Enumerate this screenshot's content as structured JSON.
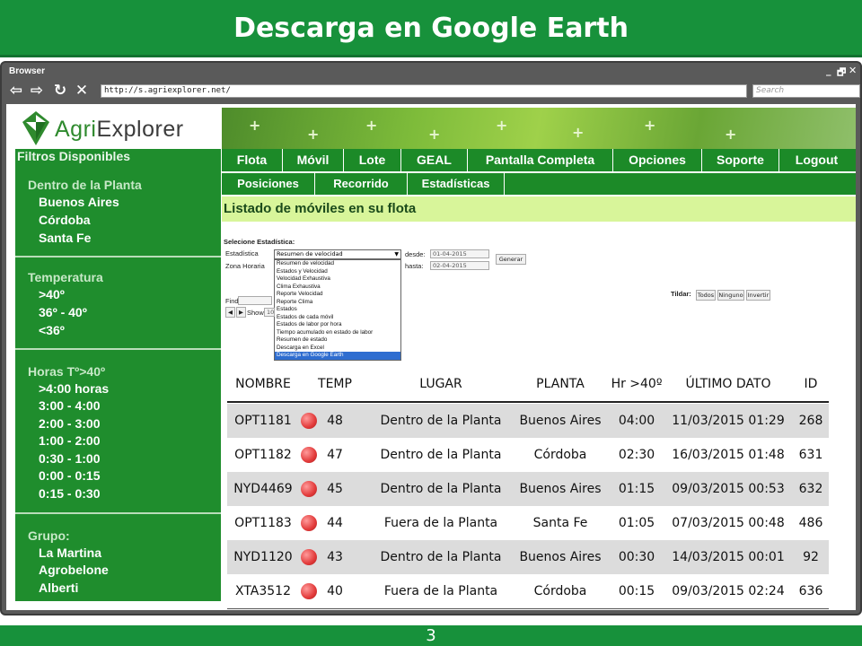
{
  "slide": {
    "title": "Descarga en Google Earth",
    "page_number": "3"
  },
  "browser": {
    "label": "Browser",
    "url": "http://s.agriexplorer.net/",
    "search_placeholder": "Search",
    "controls": {
      "minimize": "_",
      "restore": "🗗",
      "close": "✕"
    },
    "nav": {
      "back": "⇦",
      "forward": "⇨",
      "reload": "↻",
      "stop": "✕"
    }
  },
  "app": {
    "logo": {
      "prefix": "Agri",
      "suffix": "Explorer"
    },
    "sidebar": {
      "title": "Filtros Disponibles",
      "groups": [
        {
          "label": "Dentro de la Planta",
          "items": [
            "Buenos Aires",
            "Córdoba",
            "Santa Fe"
          ]
        },
        {
          "label": "Temperatura",
          "items": [
            ">40º",
            "36º - 40º",
            "<36º"
          ]
        },
        {
          "label": "Horas Tº>40º",
          "items": [
            ">4:00 horas",
            "3:00 - 4:00",
            "2:00 - 3:00",
            "1:00 - 2:00",
            "0:30 - 1:00",
            "0:00 - 0:15",
            "0:15 - 0:30"
          ]
        },
        {
          "label": "Grupo:",
          "items": [
            "La Martina",
            "Agrobelone",
            "Alberti"
          ]
        }
      ]
    },
    "main_nav": [
      "Flota",
      "Móvil",
      "Lote",
      "GEAL",
      "Pantalla Completa",
      "Opciones",
      "Soporte",
      "Logout"
    ],
    "sub_nav": [
      "Posiciones",
      "Recorrido",
      "Estadísticas"
    ],
    "list_title": "Listado de móviles en su flota",
    "form": {
      "section_label": "Selecione Estadística:",
      "estadistica_label": "Estadística",
      "zona_label": "Zona Horaria",
      "selected_value": "Resumen de velocidad",
      "options": [
        "Resumen de velocidad",
        "Estados y Velocidad",
        "Velocidad Exhaustiva",
        "Clima Exhaustiva",
        "Reporte Velocidad",
        "Reporte Clima",
        "Estados",
        "Estados de cada móvil",
        "Estados de labor por hora",
        "Tiempo acumulado en estado de labor",
        "Resumen de estado",
        "Descarga en Excel",
        "Descarga en Google Earth"
      ],
      "highlighted_option": "Descarga en Google Earth",
      "desde_label": "desde:",
      "desde_value": "01-04-2015",
      "hasta_label": "hasta:",
      "hasta_value": "02-04-2015",
      "generar_label": "Generar",
      "find_label": "Find:",
      "show_label": "Show",
      "show_value": "10",
      "tildar_label": "Tildar:",
      "tildar_todos": "Todos",
      "tildar_ninguno": "Ninguno",
      "tildar_invertir": "Invertir"
    },
    "table": {
      "headers": [
        "NOMBRE",
        "TEMP",
        "LUGAR",
        "PLANTA",
        "Hr >40º",
        "ÚLTIMO DATO",
        "ID"
      ],
      "status_color": "#e23a3a",
      "rows": [
        {
          "nombre": "OPT1181",
          "temp": "48",
          "lugar": "Dentro de la Planta",
          "planta": "Buenos Aires",
          "hr": "04:00",
          "ultimo": "11/03/2015 01:29",
          "id": "268"
        },
        {
          "nombre": "OPT1182",
          "temp": "47",
          "lugar": "Dentro de la Planta",
          "planta": "Córdoba",
          "hr": "02:30",
          "ultimo": "16/03/2015 01:48",
          "id": "631"
        },
        {
          "nombre": "NYD4469",
          "temp": "45",
          "lugar": "Dentro de la Planta",
          "planta": "Buenos Aires",
          "hr": "01:15",
          "ultimo": "09/03/2015 00:53",
          "id": "632"
        },
        {
          "nombre": "OPT1183",
          "temp": "44",
          "lugar": "Fuera de la Planta",
          "planta": "Santa Fe",
          "hr": "01:05",
          "ultimo": "07/03/2015 00:48",
          "id": "486"
        },
        {
          "nombre": "NYD1120",
          "temp": "43",
          "lugar": "Dentro de la Planta",
          "planta": "Buenos Aires",
          "hr": "00:30",
          "ultimo": "14/03/2015 00:01",
          "id": "92"
        },
        {
          "nombre": "XTA3512",
          "temp": "40",
          "lugar": "Fuera de la Planta",
          "planta": "Córdoba",
          "hr": "00:15",
          "ultimo": "09/03/2015 02:24",
          "id": "636"
        }
      ]
    }
  }
}
